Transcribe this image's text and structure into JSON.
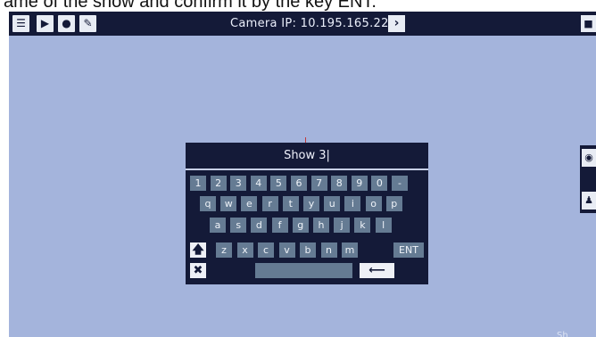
{
  "caption": {
    "text": "ame of the show and confirm it by the key ENT."
  },
  "topbar": {
    "icons": [
      "sliders-icon",
      "camera-icon",
      "user-icon",
      "wrench-icon"
    ],
    "title": "Camera IP: 10.195.165.22",
    "next_icon": "chevron-right-icon",
    "lock_icon": "lock-icon"
  },
  "side_panel": {
    "icons": [
      "eye-icon",
      "users-icon"
    ]
  },
  "bottom_label": "Sh",
  "keyboard": {
    "display_value": "Show 3|",
    "row1": [
      "1",
      "2",
      "3",
      "4",
      "5",
      "6",
      "7",
      "8",
      "9",
      "0",
      "-"
    ],
    "row2": [
      "q",
      "w",
      "e",
      "r",
      "t",
      "y",
      "u",
      "i",
      "o",
      "p"
    ],
    "row3": [
      "a",
      "s",
      "d",
      "f",
      "g",
      "h",
      "j",
      "k",
      "l"
    ],
    "row4": [
      "z",
      "x",
      "c",
      "v",
      "b",
      "n",
      "m"
    ],
    "ent_label": "ENT",
    "shift_glyph": "🡅",
    "close_glyph": "✖",
    "backspace_glyph": "⟵"
  },
  "colors": {
    "background": "#a4b4dc",
    "bar": "#141a38",
    "key": "#657b93",
    "crosshair": "#c0393b"
  }
}
